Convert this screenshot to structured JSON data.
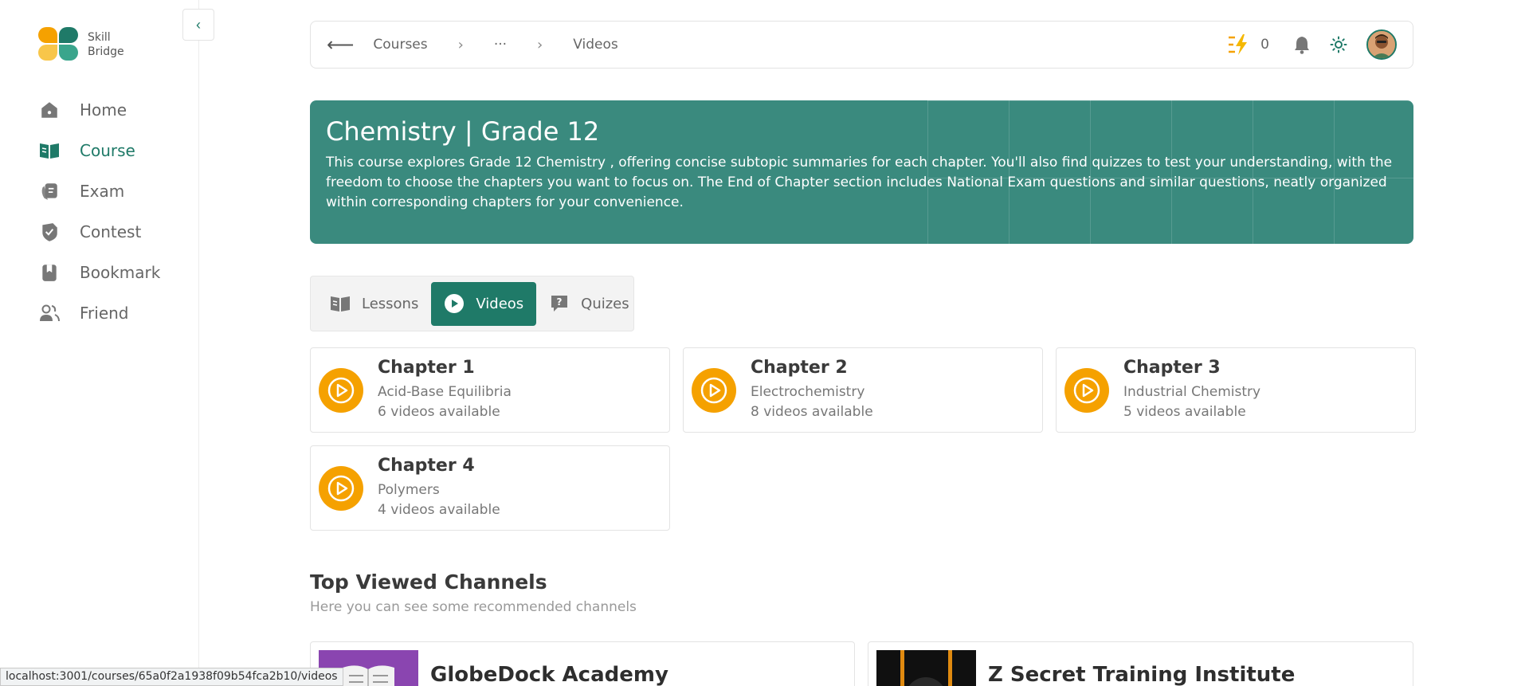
{
  "app": {
    "logo_line1": "Skill",
    "logo_line2": "Bridge",
    "brand_color": "#1f7a68",
    "accent_color": "#f5a100"
  },
  "sidebar": {
    "collapse_icon": "chevron-left-icon",
    "items": [
      {
        "label": "Home",
        "icon": "home-icon",
        "active": false
      },
      {
        "label": "Course",
        "icon": "book-open-icon",
        "active": true
      },
      {
        "label": "Exam",
        "icon": "exam-icon",
        "active": false
      },
      {
        "label": "Contest",
        "icon": "shield-icon",
        "active": false
      },
      {
        "label": "Bookmark",
        "icon": "bookmark-icon",
        "active": false
      },
      {
        "label": "Friend",
        "icon": "users-icon",
        "active": false
      }
    ]
  },
  "breadcrumb": {
    "items": [
      "Courses",
      "···",
      "Videos"
    ]
  },
  "header": {
    "streak_count": "0"
  },
  "banner": {
    "title": "Chemistry | Grade 12",
    "description": "This course explores Grade 12 Chemistry , offering concise subtopic summaries for each chapter. You'll also find quizzes to test your understanding, with the freedom to choose the chapters you want to focus on. The End of Chapter section includes National Exam questions and similar questions, neatly organized within corresponding chapters for your convenience.",
    "color": "#3a8a7e"
  },
  "tabs": [
    {
      "label": "Lessons",
      "icon": "book-icon",
      "active": false
    },
    {
      "label": "Videos",
      "icon": "play-icon",
      "active": true
    },
    {
      "label": "Quizes",
      "icon": "question-bubble-icon",
      "active": false
    }
  ],
  "chapters": [
    {
      "title": "Chapter 1",
      "topic": "Acid-Base Equilibria",
      "count": "6 videos available"
    },
    {
      "title": "Chapter 2",
      "topic": "Electrochemistry",
      "count": "8 videos available"
    },
    {
      "title": "Chapter 3",
      "topic": "Industrial Chemistry",
      "count": "5 videos available"
    },
    {
      "title": "Chapter 4",
      "topic": "Polymers",
      "count": "4 videos available"
    }
  ],
  "channels_section": {
    "title": "Top Viewed Channels",
    "subtitle": "Here you can see some recommended channels",
    "channels": [
      {
        "name": "GlobeDock Academy"
      },
      {
        "name": "Z Secret Training Institute"
      }
    ]
  },
  "status_bar": {
    "url": "localhost:3001/courses/65a0f2a1938f09b54fca2b10/videos"
  }
}
